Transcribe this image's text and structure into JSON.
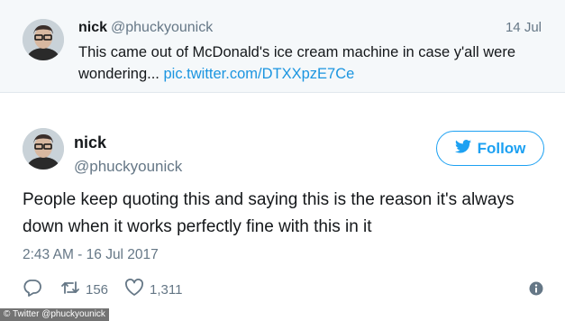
{
  "quoted_tweet": {
    "name": "nick",
    "handle": "@phuckyounick",
    "date": "14 Jul",
    "text": "This came out of McDonald's ice cream machine in case y'all were wondering...",
    "link": "pic.twitter.com/DTXXpzE7Ce"
  },
  "tweet": {
    "name": "nick",
    "handle": "@phuckyounick",
    "text": "People keep quoting this and saying this is the reason it's always down when it works perfectly fine with this in it",
    "timestamp": "2:43 AM - 16 Jul 2017",
    "retweets": "156",
    "likes": "1,311"
  },
  "follow_button": {
    "label": "Follow",
    "icon": "twitter-bird-icon"
  },
  "credit": "© Twitter @phuckyounick",
  "colors": {
    "accent": "#1da1f2",
    "link": "#1b95e0",
    "muted": "#657786",
    "quote_bg": "#f5f8fa"
  }
}
